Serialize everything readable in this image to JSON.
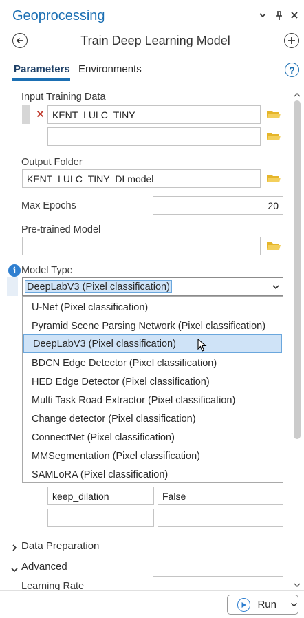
{
  "panel": {
    "title": "Geoprocessing",
    "tool_title": "Train Deep Learning Model"
  },
  "tabs": [
    {
      "label": "Parameters",
      "active": true
    },
    {
      "label": "Environments",
      "active": false
    }
  ],
  "help_label": "?",
  "params": {
    "input_training_data": {
      "label": "Input Training Data",
      "values": [
        "KENT_LULC_TINY",
        ""
      ]
    },
    "output_folder": {
      "label": "Output Folder",
      "value": "KENT_LULC_TINY_DLmodel"
    },
    "max_epochs": {
      "label": "Max Epochs",
      "value": "20"
    },
    "pretrained_model": {
      "label": "Pre-trained Model",
      "value": ""
    },
    "model_type": {
      "label": "Model Type",
      "selected": "DeepLabV3 (Pixel classification)",
      "options": [
        "U-Net (Pixel classification)",
        "Pyramid Scene Parsing Network (Pixel classification)",
        "DeepLabV3 (Pixel classification)",
        "BDCN Edge Detector (Pixel classification)",
        "HED Edge Detector (Pixel classification)",
        "Multi Task Road Extractor (Pixel classification)",
        "Change detector (Pixel classification)",
        "ConnectNet (Pixel classification)",
        "MMSegmentation (Pixel classification)",
        "SAMLoRA (Pixel classification)"
      ]
    },
    "model_args": {
      "rows": [
        {
          "name": "keep_dilation",
          "value": "False"
        },
        {
          "name": "",
          "value": ""
        }
      ]
    }
  },
  "sections": {
    "data_preparation": "Data Preparation",
    "advanced": "Advanced",
    "learning_rate": "Learning Rate"
  },
  "run_button": {
    "label": "Run"
  },
  "colors": {
    "accent": "#1b6fb3",
    "selection": "#cfe3f7",
    "folder": "#e5b52a",
    "error_x": "#c0392b",
    "info": "#2f7fd0"
  }
}
